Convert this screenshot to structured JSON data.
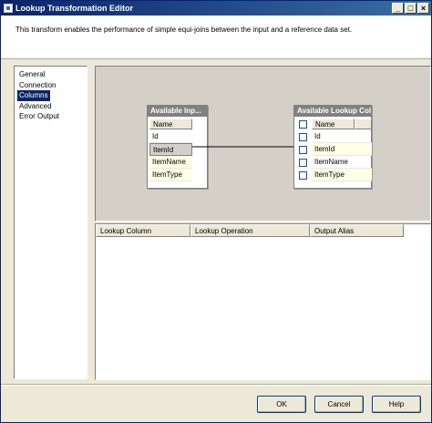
{
  "window": {
    "title": "Lookup Transformation Editor",
    "min_glyph": "_",
    "max_glyph": "□",
    "close_glyph": "×",
    "description": "This transform enables the performance of simple equi-joins between the input and a reference data set."
  },
  "nav": {
    "items": [
      {
        "label": "General"
      },
      {
        "label": "Connection"
      },
      {
        "label": "Columns"
      },
      {
        "label": "Advanced"
      },
      {
        "label": "Error Output"
      }
    ],
    "selected": "Columns"
  },
  "input_table": {
    "title": "Available Inp...",
    "header": "Name",
    "rows": [
      "Id",
      "ItemId",
      "ItemName",
      "ItemType"
    ]
  },
  "lookup_table": {
    "title": "Available Lookup Colu...",
    "header": "Name",
    "rows": [
      "Id",
      "ItemId",
      "ItemName",
      "ItemType"
    ]
  },
  "grid": {
    "columns": [
      "Lookup Column",
      "Lookup Operation",
      "Output Alias"
    ]
  },
  "buttons": {
    "ok": "OK",
    "cancel": "Cancel",
    "help": "Help"
  }
}
